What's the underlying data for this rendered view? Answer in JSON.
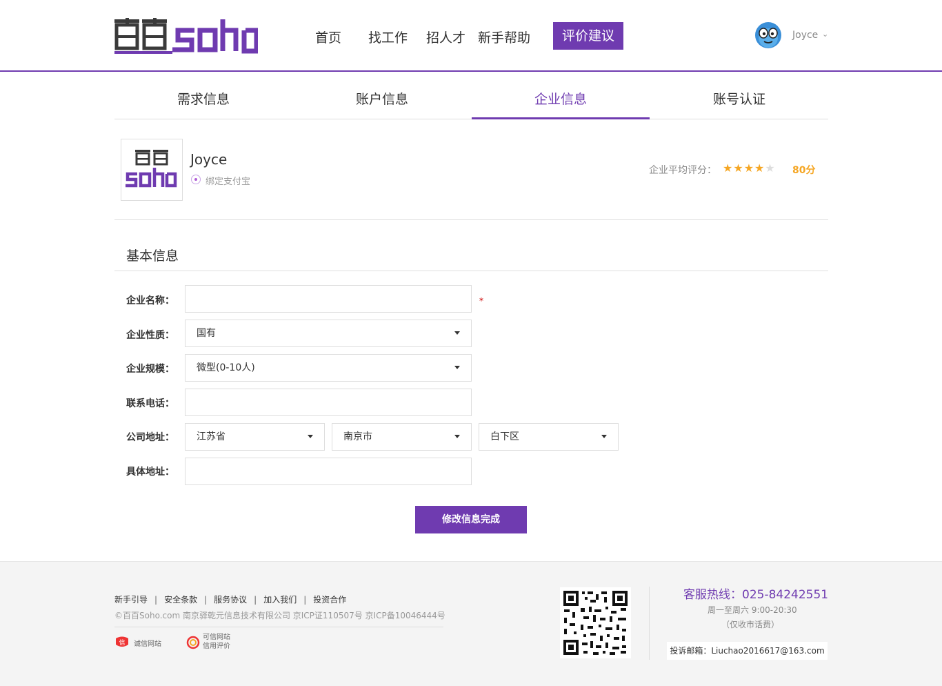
{
  "header": {
    "logo_text": "百百soho",
    "nav": [
      "首页",
      "找工作",
      "招人才",
      "新手帮助"
    ],
    "nav_active": "评价建议",
    "user_name": "Joyce",
    "user_caret": "⌄"
  },
  "tabs": [
    "需求信息",
    "账户信息",
    "企业信息",
    "账号认证"
  ],
  "company": {
    "name": "Joyce",
    "alipay_label": "绑定支付宝",
    "rating_label": "企业平均评分：",
    "rating_stars": 4,
    "rating_max": 5,
    "rating_score": "80分"
  },
  "form": {
    "section_title": "基本信息",
    "name_label": "企业名称：",
    "name_value": "",
    "required_mark": "*",
    "nature_label": "企业性质：",
    "nature_value": "国有",
    "scale_label": "企业规模：",
    "scale_value": "微型(0-10人)",
    "phone_label": "联系电话：",
    "phone_value": "",
    "address_label": "公司地址：",
    "province": "江苏省",
    "city": "南京市",
    "district": "白下区",
    "detail_label": "具体地址：",
    "detail_value": "",
    "submit_label": "修改信息完成"
  },
  "footer": {
    "links": [
      "新手引导",
      "安全条款",
      "服务协议",
      "加入我们",
      "投资合作"
    ],
    "link_sep": "|",
    "copyright": "©百百Soho.com  南京驿乾元信息技术有限公司  京ICP证110507号  京ICP备10046444号",
    "badge1": "诚信网站",
    "badge2_line1": "可信网站",
    "badge2_line2": "信用评价",
    "hotline": "客服热线：025-84242551",
    "hours": "周一至周六 9:00-20:30",
    "hours_note": "（仅收市话费）",
    "email": "投诉邮箱：Liuchao2016617@163.com"
  },
  "colors": {
    "brand": "#6f3bb0",
    "star": "#f5a623"
  }
}
